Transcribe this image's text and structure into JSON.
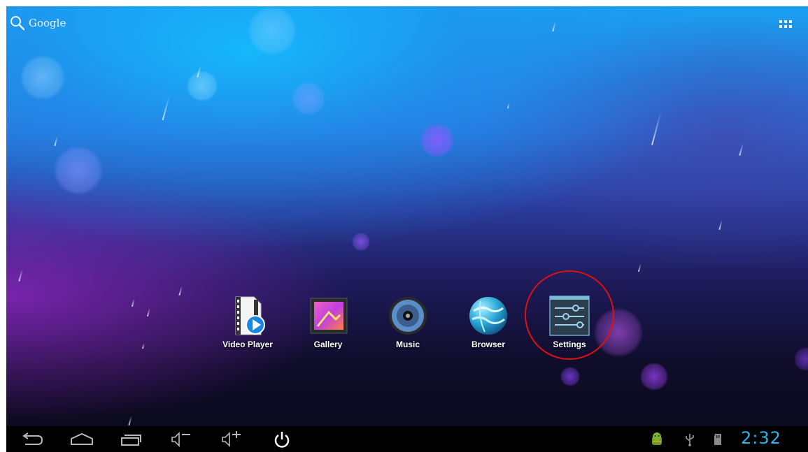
{
  "search": {
    "label": "Google"
  },
  "apps": [
    {
      "label": "Video Player",
      "icon": "video-player-icon"
    },
    {
      "label": "Gallery",
      "icon": "gallery-icon"
    },
    {
      "label": "Music",
      "icon": "music-icon"
    },
    {
      "label": "Browser",
      "icon": "browser-icon"
    },
    {
      "label": "Settings",
      "icon": "settings-icon",
      "highlighted": true
    }
  ],
  "navbar": {
    "buttons": [
      "back-icon",
      "home-icon",
      "recent-apps-icon",
      "volume-down-icon",
      "volume-up-icon",
      "power-icon"
    ],
    "status_icons": [
      "android-debug-icon",
      "usb-icon",
      "sd-card-icon"
    ],
    "clock": "2:32"
  },
  "colors": {
    "clock": "#2ab4e8",
    "highlight_circle": "#e01010",
    "navbar": "#000000"
  }
}
